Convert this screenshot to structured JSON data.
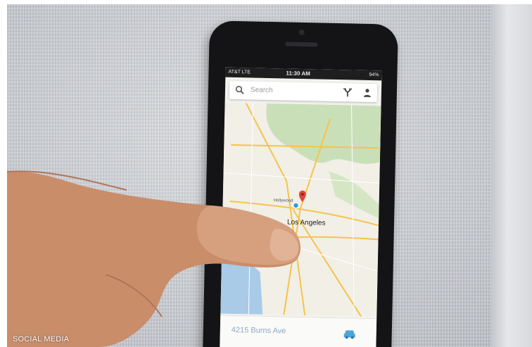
{
  "status_bar": {
    "carrier": "AT&T LTE",
    "time": "11:30 AM",
    "battery": "94%"
  },
  "search": {
    "placeholder": "Search"
  },
  "icons": {
    "search": "search-icon",
    "directions": "directions-icon",
    "account": "account-icon",
    "map_pin": "map-pin-icon",
    "location": "current-location-dot",
    "car": "car-icon"
  },
  "map": {
    "labels": {
      "hollywood": "Hollywood",
      "los_angeles": "Los Angeles"
    }
  },
  "bottom_bar": {
    "address": "4215 Burns Ave"
  },
  "watermark": "SOCIAL MEDIA",
  "colors": {
    "pin": "#e0453a",
    "location_dot": "#2f9be4",
    "map_land": "#f1efe6",
    "map_park": "#c9dfb8",
    "map_water": "#a9cbe8",
    "highway": "#f5c44a",
    "address_text": "#8fa9bd"
  }
}
